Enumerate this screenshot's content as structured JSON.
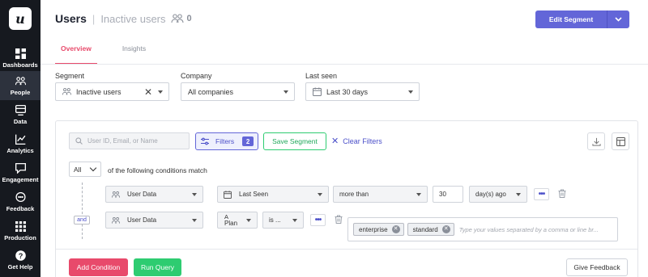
{
  "sidebar": {
    "logo": "u",
    "items": [
      {
        "label": "Dashboards",
        "icon": "dashboards-icon",
        "active": false
      },
      {
        "label": "People",
        "icon": "people-icon",
        "active": true
      },
      {
        "label": "Data",
        "icon": "data-icon",
        "active": false
      },
      {
        "label": "Analytics",
        "icon": "analytics-icon",
        "active": false
      },
      {
        "label": "Engagement",
        "icon": "engagement-icon",
        "active": false
      },
      {
        "label": "Feedback",
        "icon": "feedback-icon",
        "active": false
      },
      {
        "label": "Production",
        "icon": "production-icon",
        "active": false
      },
      {
        "label": "Get Help",
        "icon": "help-icon",
        "active": false
      }
    ]
  },
  "header": {
    "title": "Users",
    "separator": "|",
    "segment_name": "Inactive users",
    "user_count": "0",
    "edit_button": "Edit Segment"
  },
  "tabs": [
    {
      "label": "Overview",
      "active": true
    },
    {
      "label": "Insights",
      "active": false
    }
  ],
  "filters": {
    "segment": {
      "label": "Segment",
      "value": "Inactive users"
    },
    "company": {
      "label": "Company",
      "value": "All companies"
    },
    "last_seen": {
      "label": "Last seen",
      "value": "Last 30 days"
    }
  },
  "builder": {
    "search_placeholder": "User ID, Email, or Name",
    "filters_label": "Filters",
    "filters_count": "2",
    "save_segment": "Save Segment",
    "clear_filters": "Clear Filters",
    "match_value": "All",
    "match_text": "of the following conditions match",
    "and_label": "and",
    "conditions": [
      {
        "source": "User Data",
        "field": "Last Seen",
        "operator": "more than",
        "value": "30",
        "unit": "day(s) ago"
      },
      {
        "source": "User Data",
        "field_line1": "A",
        "field_line2": "Plan",
        "operator": "is ...",
        "tags": [
          "enterprise",
          "standard"
        ],
        "placeholder": "Type your values separated by a comma or line br..."
      }
    ],
    "add_condition": "Add Condition",
    "run_query": "Run Query",
    "give_feedback": "Give Feedback"
  },
  "colors": {
    "sidebar_bg": "#16191f",
    "accent": "#6366d8",
    "tab_active": "#e84a6b",
    "success": "#2ecc71"
  }
}
